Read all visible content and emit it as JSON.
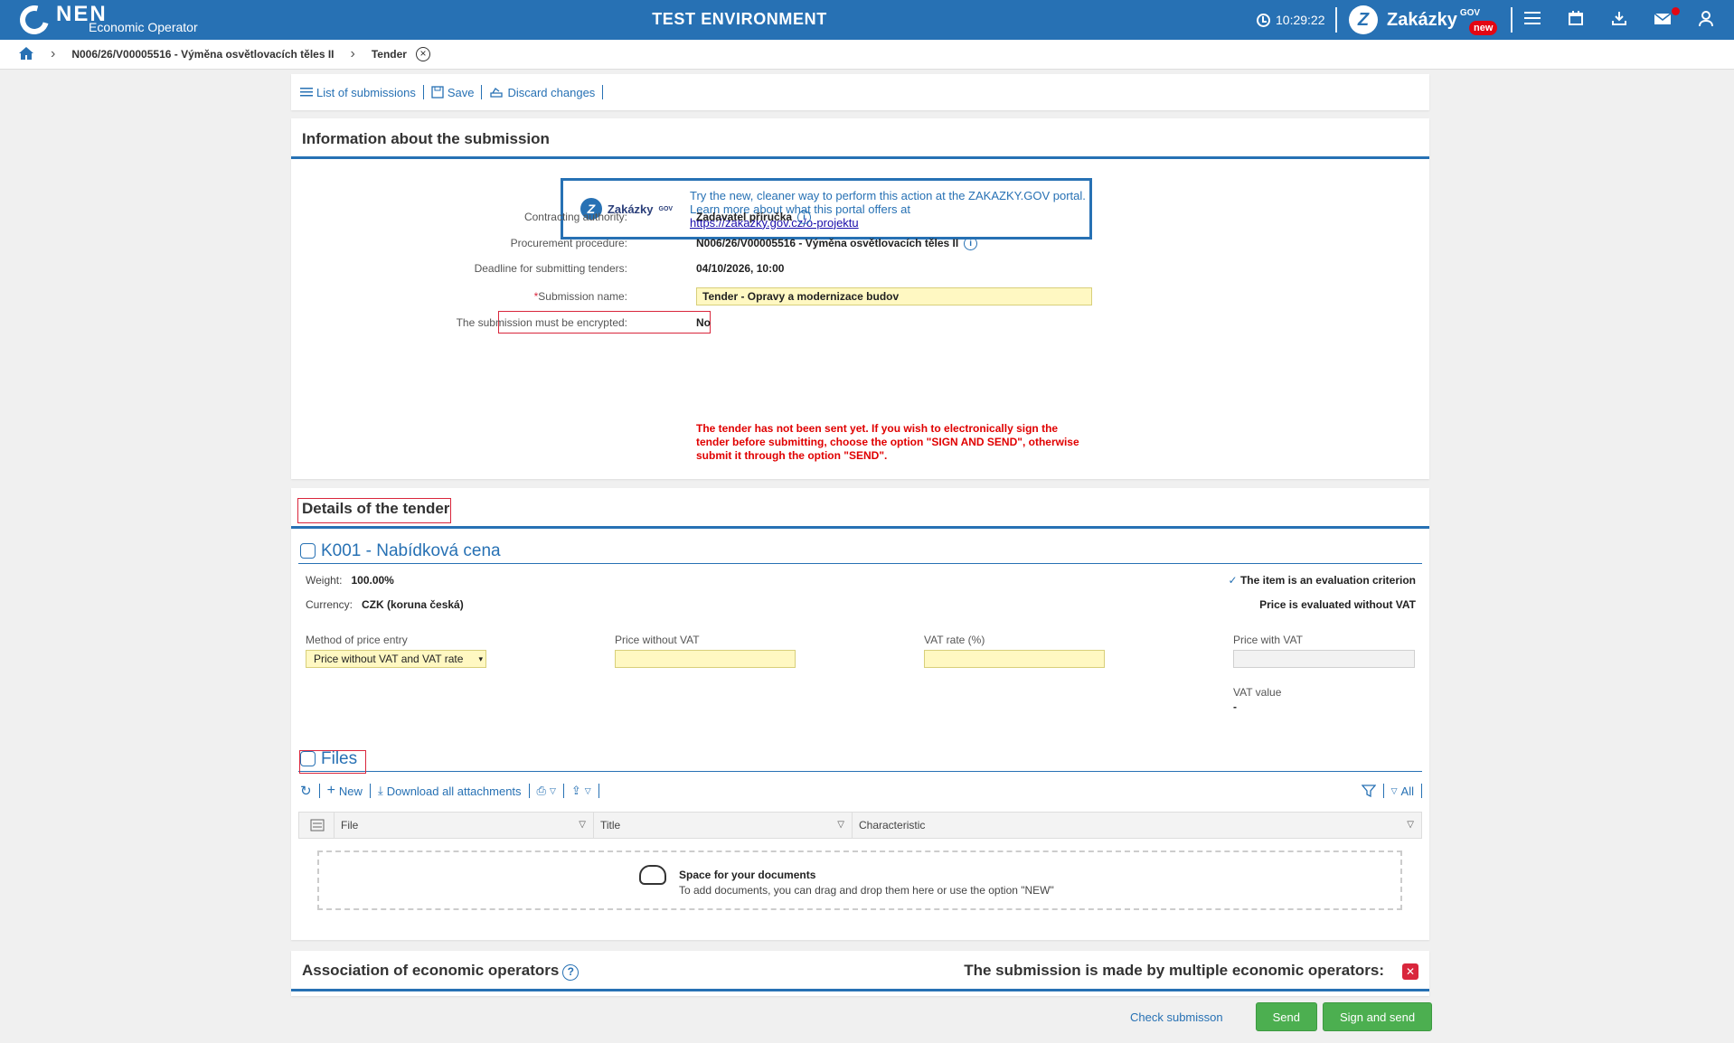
{
  "header": {
    "logo_text": "NEN",
    "logo_subtitle": "Economic Operator",
    "environment": "TEST ENVIRONMENT",
    "time": "10:29:22",
    "portal_name": "Zakázky",
    "portal_sup": "GOV",
    "portal_badge": "new",
    "icons": [
      "menu-icon",
      "calendar-icon",
      "download-icon",
      "mail-icon",
      "user-icon"
    ]
  },
  "breadcrumb": {
    "items": [
      "N006/26/V00005516 - Výměna osvětlovacích těles II",
      "Tender"
    ]
  },
  "toolbar": {
    "list_label": "List of submissions",
    "save_label": "Save",
    "discard_label": "Discard changes"
  },
  "info": {
    "title": "Information about the submission",
    "banner": {
      "logo": "Zakázky",
      "logo_sup": "GOV",
      "text": "Try the new, cleaner way to perform this action at the ZAKAZKY.GOV portal. Learn more about what this portal offers at",
      "link": "https://zakazky.gov.cz/o-projektu"
    },
    "contracting_authority_label": "Contracting authority:",
    "contracting_authority": "Zadavatel příručka",
    "procedure_label": "Procurement procedure:",
    "procedure": "N006/26/V00005516 - Výměna osvětlovacích těles II",
    "deadline_label": "Deadline for submitting tenders:",
    "deadline": "04/10/2026, 10:00",
    "name_label": "Submission name:",
    "name_value": "Tender - Opravy a modernizace budov",
    "encrypted_label": "The submission must be encrypted:",
    "encrypted_value": "No",
    "warning": "The tender has not been sent yet. If you wish to electronically sign the tender before submitting, choose the option \"SIGN AND SEND\", otherwise submit it through the option \"SEND\"."
  },
  "details": {
    "title": "Details of the tender",
    "item_title": "K001 - Nabídková cena",
    "weight_label": "Weight:",
    "weight": "100.00%",
    "currency_label": "Currency:",
    "currency": "CZK (koruna česká)",
    "criterion": "The item is an evaluation criterion",
    "evaluated": "Price is evaluated without VAT",
    "method_label": "Method of price entry",
    "method_value": "Price without VAT and VAT rate",
    "price_without_label": "Price without VAT",
    "vat_rate_label": "VAT rate (%)",
    "price_with_label": "Price with VAT",
    "vat_value_label": "VAT value",
    "vat_value": "-"
  },
  "files": {
    "title": "Files",
    "new_label": "New",
    "download_label": "Download all attachments",
    "all_label": "All",
    "columns": [
      "File",
      "Title",
      "Characteristic"
    ],
    "drop_title": "Space for your documents",
    "drop_text": "To add documents, you can drag and drop them here or use the option \"NEW\""
  },
  "association": {
    "title": "Association of economic operators",
    "multiple_label": "The submission is made by multiple economic operators:"
  },
  "actions": {
    "check": "Check submisson",
    "send": "Send",
    "sign_send": "Sign and send"
  }
}
